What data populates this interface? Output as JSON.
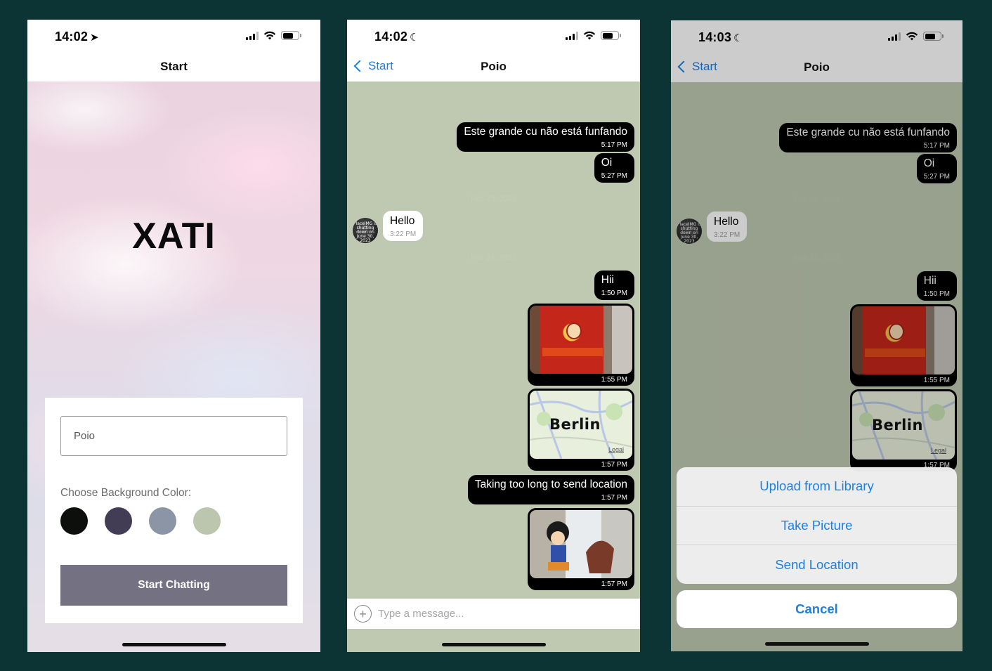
{
  "colors": {
    "outer_bg": "#0d3435",
    "accent": "#1f7fe0",
    "chat_bg": "#bfc9b2"
  },
  "screens": [
    {
      "status": {
        "time": "14:02",
        "glyph": "➤"
      },
      "nav_title": "Start",
      "app_title": "XATI",
      "name_input": {
        "value": "Poio"
      },
      "color_label": "Choose Background Color:",
      "swatches": [
        "#0c0f0b",
        "#423d54",
        "#8b95a6",
        "#bcc5ae"
      ],
      "start_button": "Start Chatting"
    },
    {
      "status": {
        "time": "14:02",
        "glyph": "☾"
      },
      "back_label": "Start",
      "nav_title": "Poio",
      "messages": [
        {
          "text": "Este grande cu não está funfando",
          "time": "5:17 PM"
        },
        {
          "text": "Oi",
          "time": "5:27 PM"
        },
        {
          "date": "Feb 23, 2023"
        },
        {
          "text": "Hello",
          "time": "3:22 PM"
        },
        {
          "date": "Feb 24, 2023"
        },
        {
          "text": "Hii",
          "time": "1:50 PM"
        },
        {
          "time": "1:55 PM"
        },
        {
          "time": "1:57 PM",
          "map_label": "Berlin",
          "map_legal": "Legal"
        },
        {
          "text": "Taking too long to send location",
          "time": "1:57 PM"
        },
        {
          "time": "1:57 PM"
        }
      ],
      "avatar_text": "PlacelMG is shutting down on June 30, 2023",
      "input_placeholder": "Type a message..."
    },
    {
      "status": {
        "time": "14:03",
        "glyph": "☾"
      },
      "back_label": "Start",
      "nav_title": "Poio",
      "messages": [
        {
          "text": "Este grande cu não está funfando",
          "time": "5:17 PM"
        },
        {
          "text": "Oi",
          "time": "5:27 PM"
        },
        {
          "date": "Feb 23, 2023"
        },
        {
          "text": "Hello",
          "time": "3:22 PM"
        },
        {
          "date": "Feb 24, 2023"
        },
        {
          "text": "Hii",
          "time": "1:50 PM"
        },
        {
          "time": "1:55 PM"
        },
        {
          "time": "1:57 PM",
          "map_label": "Berlin",
          "map_legal": "Legal"
        }
      ],
      "avatar_text": "PlacelMG is shutting down on June 30, 2023",
      "actions": [
        "Upload from Library",
        "Take Picture",
        "Send Location"
      ],
      "cancel": "Cancel"
    }
  ]
}
